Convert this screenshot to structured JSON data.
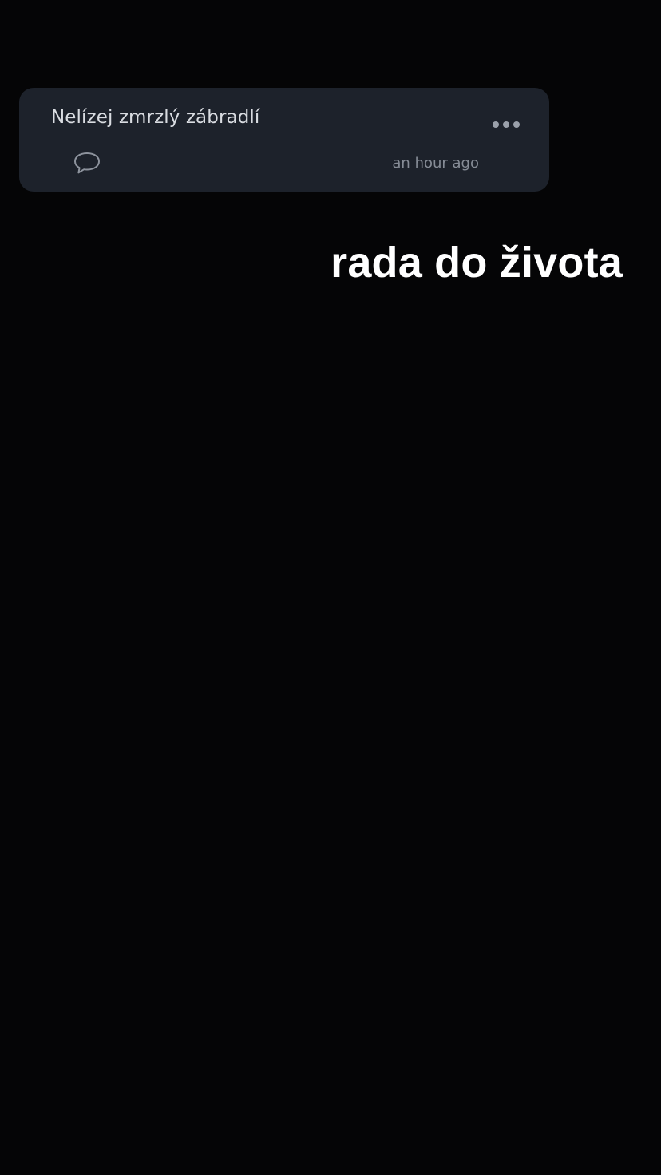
{
  "post": {
    "text": "Nelízej zmrzlý zábradlí",
    "timestamp": "an hour ago",
    "icons": {
      "comment": "speech-bubble-icon",
      "more": "ellipsis-icon"
    }
  },
  "caption": {
    "text": "rada do života"
  },
  "colors": {
    "background": "#050506",
    "card": "#1d222b",
    "post_text": "#d9dce1",
    "muted": "#868c96",
    "caption": "#ffffff"
  }
}
